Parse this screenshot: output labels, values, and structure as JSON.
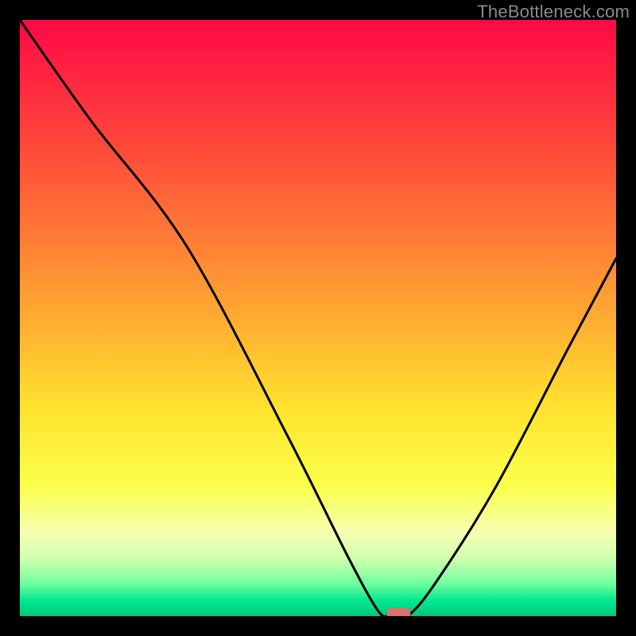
{
  "watermark": "TheBottleneck.com",
  "chart_data": {
    "type": "line",
    "title": "",
    "xlabel": "",
    "ylabel": "",
    "xlim": [
      0,
      100
    ],
    "ylim": [
      0,
      100
    ],
    "series": [
      {
        "name": "bottleneck-curve",
        "x": [
          0,
          12,
          28,
          45,
          55,
          60,
          62,
          65,
          70,
          80,
          92,
          100
        ],
        "values": [
          100,
          83,
          62,
          30,
          10,
          1,
          0,
          0,
          6,
          22,
          45,
          60
        ]
      }
    ],
    "marker": {
      "x": 63.5,
      "y": 0.5,
      "label": "optimal-point"
    },
    "gradient_stops": [
      {
        "offset": 0.0,
        "color": "#ff0945"
      },
      {
        "offset": 0.22,
        "color": "#ff4b3a"
      },
      {
        "offset": 0.45,
        "color": "#ff9933"
      },
      {
        "offset": 0.65,
        "color": "#ffe22e"
      },
      {
        "offset": 0.78,
        "color": "#faff4a"
      },
      {
        "offset": 0.86,
        "color": "#f6ffb3"
      },
      {
        "offset": 0.905,
        "color": "#ccffad"
      },
      {
        "offset": 0.945,
        "color": "#6fff9f"
      },
      {
        "offset": 0.975,
        "color": "#00e78f"
      },
      {
        "offset": 1.0,
        "color": "#00c579"
      }
    ]
  }
}
